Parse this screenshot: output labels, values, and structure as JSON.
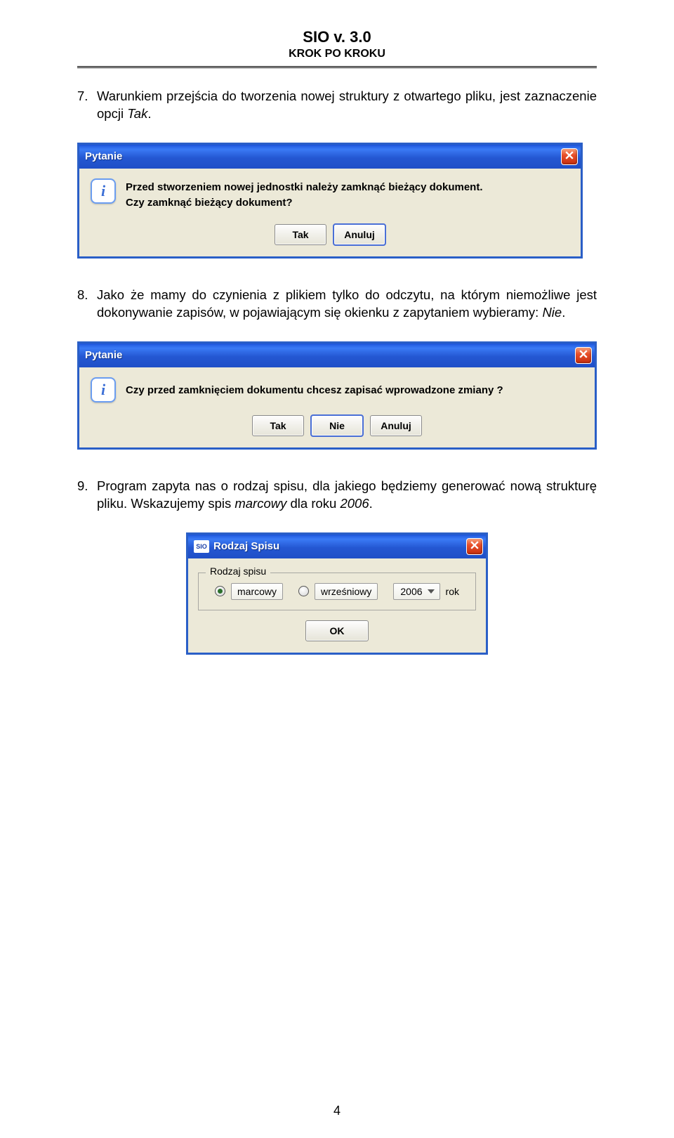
{
  "header": {
    "title": "SIO v. 3.0",
    "subtitle": "KROK PO KROKU"
  },
  "para7": {
    "num": "7.",
    "text_a": "Warunkiem przejścia do tworzenia nowej struktury z otwartego pliku, jest zaznaczenie opcji ",
    "text_italic": "Tak",
    "text_b": "."
  },
  "dialog1": {
    "title": "Pytanie",
    "line1": "Przed stworzeniem nowej jednostki należy zamknąć bieżący dokument.",
    "line2": "Czy zamknąć bieżący dokument?",
    "btn_tak": "Tak",
    "btn_anuluj": "Anuluj"
  },
  "para8": {
    "num": "8.",
    "text_a": "Jako że mamy do czynienia z plikiem tylko do odczytu, na którym niemożliwe jest dokonywanie zapisów, w pojawiającym się okienku z zapytaniem wybieramy: ",
    "text_italic": "Nie",
    "text_b": "."
  },
  "dialog2": {
    "title": "Pytanie",
    "line1": "Czy przed zamknięciem dokumentu chcesz zapisać wprowadzone zmiany ?",
    "btn_tak": "Tak",
    "btn_nie": "Nie",
    "btn_anuluj": "Anuluj"
  },
  "para9": {
    "num": "9.",
    "text_a": "Program zapyta nas o rodzaj spisu, dla jakiego będziemy generować nową strukturę pliku. Wskazujemy spis ",
    "text_italic": "marcowy",
    "text_b": " dla roku ",
    "text_italic2": "2006",
    "text_c": "."
  },
  "dialog3": {
    "icon_text": "SIO",
    "title": "Rodzaj Spisu",
    "fieldset_legend": "Rodzaj spisu",
    "opt_marcowy": "marcowy",
    "opt_wrzesniowy": "wrześniowy",
    "year": "2006",
    "year_suffix": "rok",
    "btn_ok": "OK"
  },
  "page_number": "4"
}
